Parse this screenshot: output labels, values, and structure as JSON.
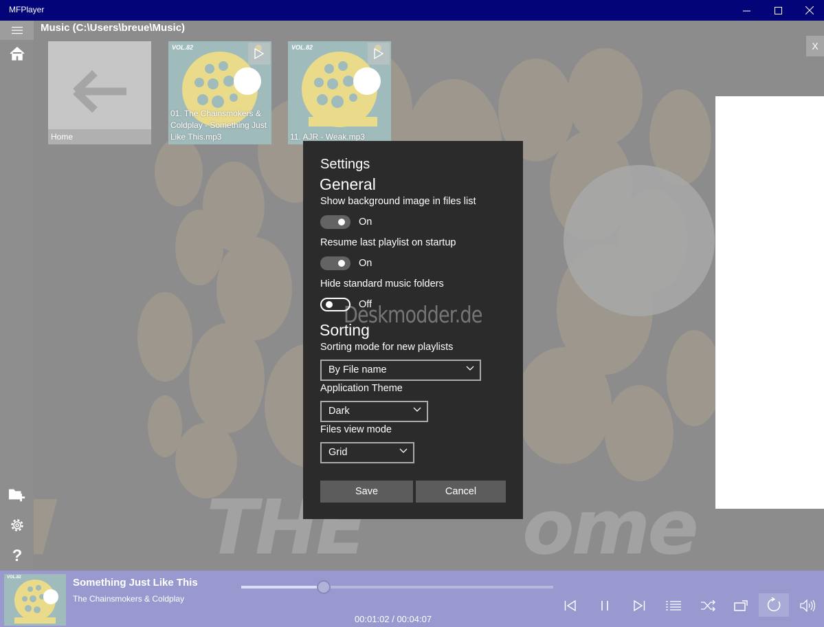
{
  "window": {
    "title": "MFPlayer"
  },
  "header": {
    "path_title": "Music (C:\\Users\\breue\\Music)"
  },
  "tiles": [
    {
      "label": "Home"
    },
    {
      "label": "01. The Chainsmokers & Coldplay - Something Just Like This.mp3",
      "badge": "VOL.82"
    },
    {
      "label": "11. AJR - Weak.mp3",
      "badge": "VOL.82"
    }
  ],
  "close_panel": "X",
  "settings": {
    "title": "Settings",
    "general_heading": "General",
    "show_bg_label": "Show background image in files list",
    "show_bg_state": "On",
    "resume_label": "Resume last playlist on startup",
    "resume_state": "On",
    "hide_folders_label": "Hide standard music folders",
    "hide_folders_state": "Off",
    "sorting_heading": "Sorting",
    "sorting_mode_label": "Sorting mode for new playlists",
    "sorting_mode_value": "By File name",
    "theme_label": "Application Theme",
    "theme_value": "Dark",
    "view_mode_label": "Files view mode",
    "view_mode_value": "Grid",
    "save_label": "Save",
    "cancel_label": "Cancel"
  },
  "watermark": "Deskmodder.de",
  "player": {
    "song_title": "Something Just Like This",
    "artist": "The Chainsmokers & Coldplay",
    "time": "00:01:02 / 00:04:07",
    "progress": 0.265,
    "cover_badge": "VOL.82"
  },
  "colors": {
    "titlebar": "#040479",
    "player_bar": "#9999cf",
    "dialog_bg": "#2b2b2b"
  }
}
